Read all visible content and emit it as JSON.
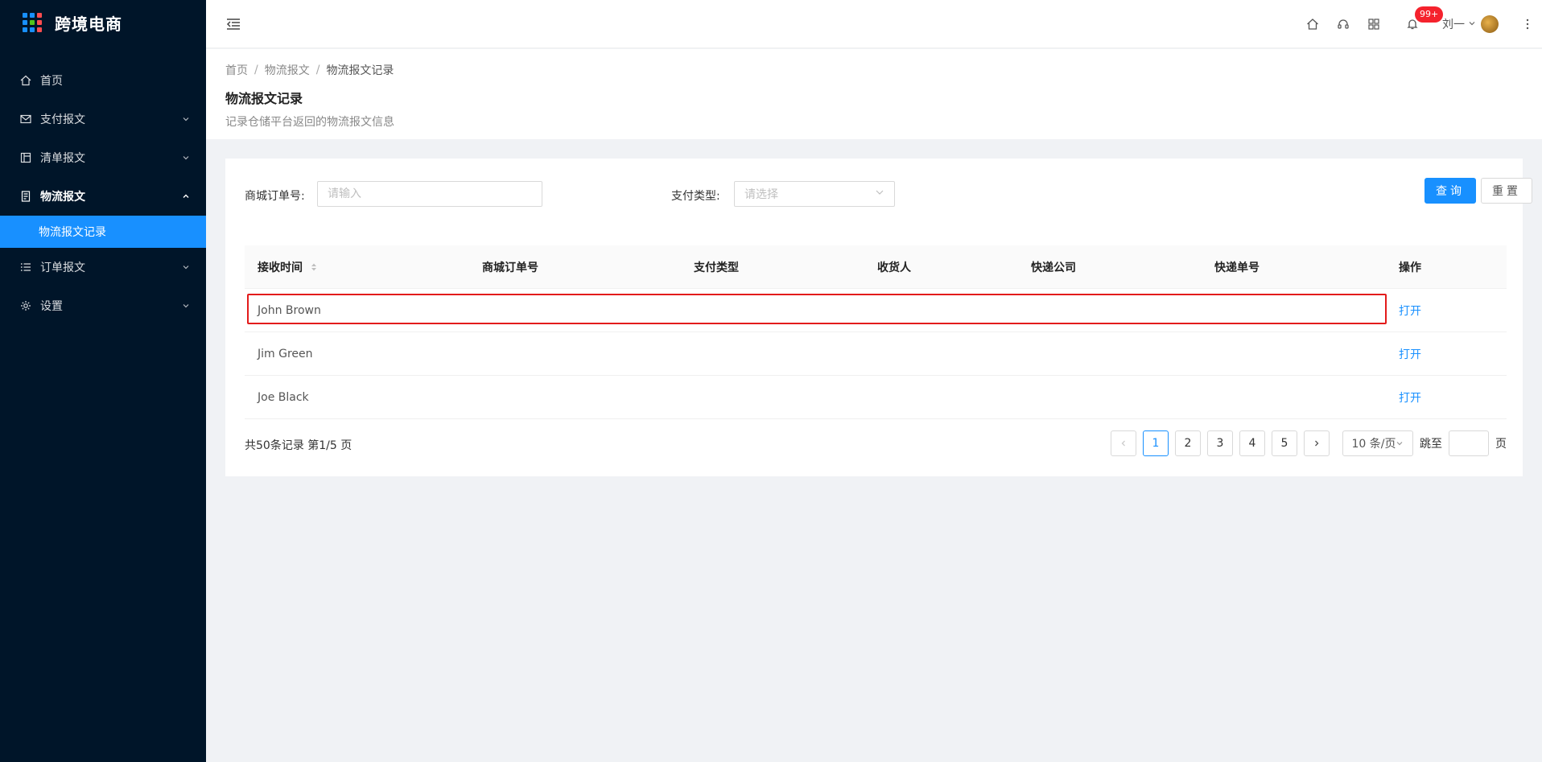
{
  "app": {
    "title": "跨境电商"
  },
  "sidebar": {
    "items": [
      {
        "label": "首页",
        "icon": "home-icon"
      },
      {
        "label": "支付报文",
        "icon": "mail-icon"
      },
      {
        "label": "清单报文",
        "icon": "list-doc-icon"
      },
      {
        "label": "物流报文",
        "icon": "logistics-doc-icon"
      },
      {
        "label": "物流报文记录"
      },
      {
        "label": "订单报文",
        "icon": "ordered-list-icon"
      },
      {
        "label": "设置",
        "icon": "gear-icon"
      }
    ]
  },
  "header": {
    "notification_badge": "99+",
    "user_name": "刘一"
  },
  "breadcrumb": [
    "首页",
    "物流报文",
    "物流报文记录"
  ],
  "page": {
    "title": "物流报文记录",
    "description": "记录仓储平台返回的物流报文信息"
  },
  "filters": {
    "order_no_label": "商城订单号:",
    "order_no_placeholder": "请输入",
    "pay_type_label": "支付类型:",
    "pay_type_placeholder": "请选择",
    "query_button": "查询",
    "reset_button": "重置"
  },
  "table": {
    "columns": [
      "接收时间",
      "商城订单号",
      "支付类型",
      "收货人",
      "快递公司",
      "快递单号",
      "操作"
    ],
    "rows": [
      {
        "name": "John Brown",
        "action": "打开"
      },
      {
        "name": "Jim Green",
        "action": "打开"
      },
      {
        "name": "Joe Black",
        "action": "打开"
      }
    ]
  },
  "pagination": {
    "summary": "共50条记录 第1/5 页",
    "pages": [
      "1",
      "2",
      "3",
      "4",
      "5"
    ],
    "current": "1",
    "page_size": "10 条/页",
    "jump_label": "跳至",
    "page_suffix": "页"
  },
  "colors": {
    "sidebar_bg": "#001529",
    "primary": "#1890ff",
    "highlight_border": "#e31b1b",
    "badge": "#f5222d"
  }
}
